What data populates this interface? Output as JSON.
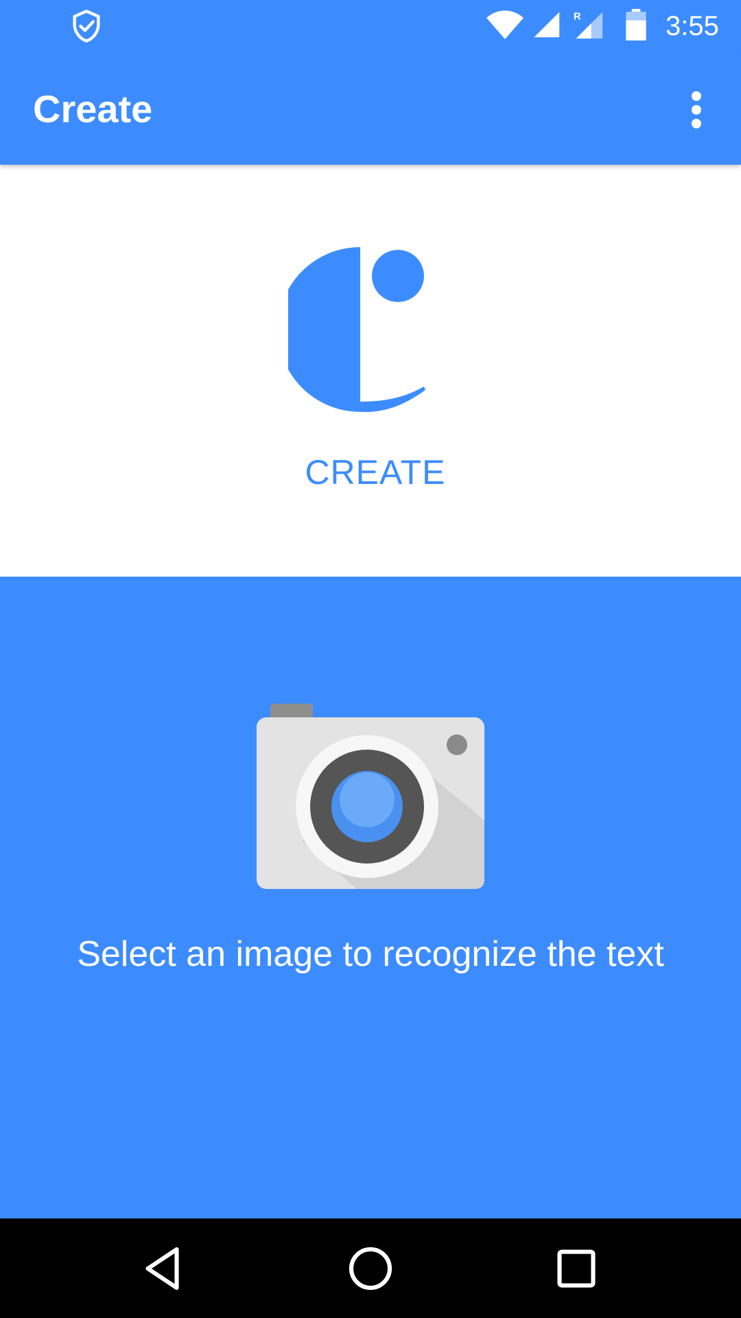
{
  "status_bar": {
    "time": "3:55",
    "icons": [
      "shield-check-icon",
      "wifi-icon",
      "cell-signal-icon",
      "cell-signal-roaming-icon",
      "battery-icon"
    ],
    "roaming_letter": "R"
  },
  "app_bar": {
    "title": "Create",
    "overflow_icon": "more-vert-icon"
  },
  "logo": {
    "icon": "create-logo-icon",
    "text": "CREATE"
  },
  "picker": {
    "icon": "camera-icon",
    "hint": "Select an image to recognize the text"
  },
  "nav_bar": {
    "icons": [
      "back-icon",
      "home-icon",
      "recents-icon"
    ]
  },
  "colors": {
    "primary": "#3d8cff",
    "background": "#ffffff",
    "nav_bar": "#000000",
    "camera_body": "#e3e3e3",
    "camera_lens_ring": "#555555",
    "camera_lens": "#4a90f0"
  }
}
